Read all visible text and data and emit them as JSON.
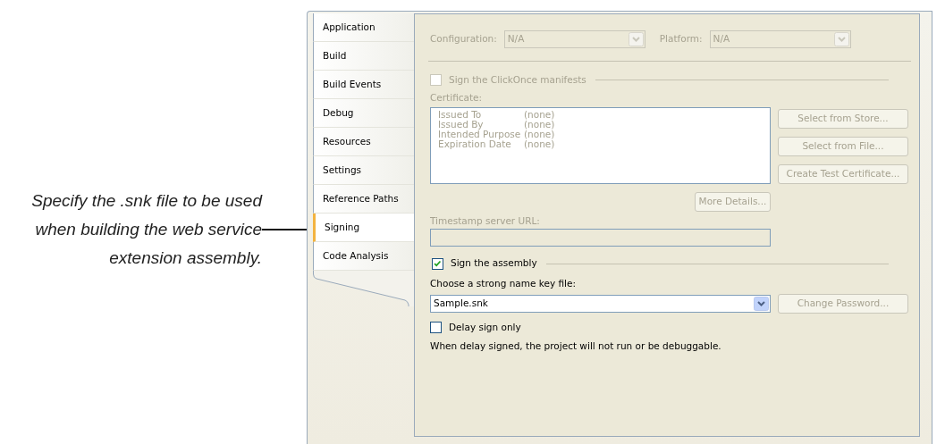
{
  "annotation": {
    "text": "Specify the .snk file to be used when building the web service extension assembly."
  },
  "tabs": [
    {
      "label": "Application",
      "selected": false
    },
    {
      "label": "Build",
      "selected": false
    },
    {
      "label": "Build Events",
      "selected": false
    },
    {
      "label": "Debug",
      "selected": false
    },
    {
      "label": "Resources",
      "selected": false
    },
    {
      "label": "Settings",
      "selected": false
    },
    {
      "label": "Reference Paths",
      "selected": false
    },
    {
      "label": "Signing",
      "selected": true
    },
    {
      "label": "Code Analysis",
      "selected": false
    }
  ],
  "configuration": {
    "label": "Configuration:",
    "value": "N/A",
    "disabled": true
  },
  "platform": {
    "label": "Platform:",
    "value": "N/A",
    "disabled": true
  },
  "clickonce": {
    "label": "Sign the ClickOnce manifests",
    "checked": false,
    "disabled": true
  },
  "certificate": {
    "label": "Certificate:",
    "disabled": true,
    "rows": [
      {
        "name": "Issued To",
        "value": "(none)"
      },
      {
        "name": "Issued By",
        "value": "(none)"
      },
      {
        "name": "Intended Purpose",
        "value": "(none)"
      },
      {
        "name": "Expiration Date",
        "value": "(none)"
      }
    ]
  },
  "certificate_buttons": [
    {
      "label": "Select from Store...",
      "disabled": true
    },
    {
      "label": "Select from File...",
      "disabled": true
    },
    {
      "label": "Create Test Certificate...",
      "disabled": true
    }
  ],
  "more_details": {
    "label": "More Details...",
    "disabled": true
  },
  "timestamp": {
    "label": "Timestamp server URL:",
    "disabled": true
  },
  "sign_assembly": {
    "label": "Sign the assembly",
    "checked": true,
    "disabled": false
  },
  "key_file": {
    "label": "Choose a strong name key file:",
    "value": "Sample.snk",
    "disabled": false
  },
  "change_password": {
    "label": "Change Password...",
    "disabled": true
  },
  "delay_sign": {
    "label": "Delay sign only",
    "checked": false,
    "disabled": false
  },
  "note": "When delay signed, the project will not run or be debuggable."
}
